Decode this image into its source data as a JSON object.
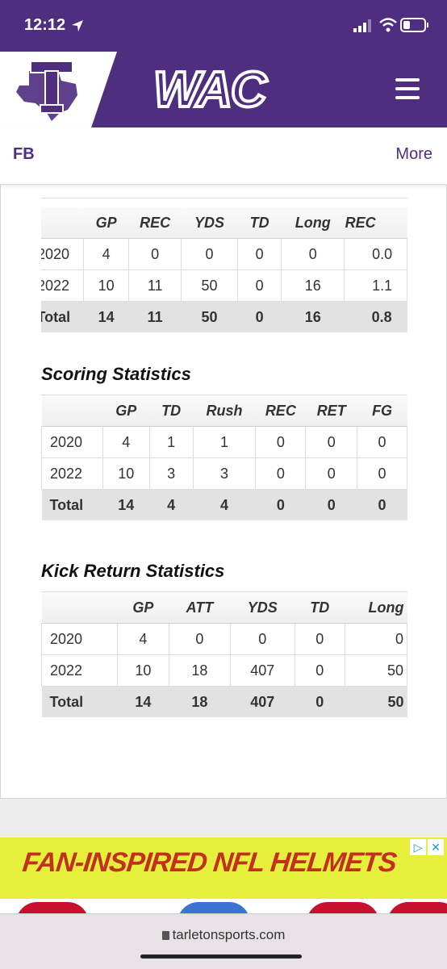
{
  "status": {
    "time": "12:12"
  },
  "header": {
    "brand_text": "WAC"
  },
  "subnav": {
    "left_label": "FB",
    "right_label": "More"
  },
  "receiving": {
    "columns": [
      "",
      "GP",
      "REC",
      "YDS",
      "TD",
      "Long",
      "REC"
    ],
    "rows": [
      [
        "2020",
        "4",
        "0",
        "0",
        "0",
        "0",
        "0.0"
      ],
      [
        "2022",
        "10",
        "11",
        "50",
        "0",
        "16",
        "1.1"
      ],
      [
        "Total",
        "14",
        "11",
        "50",
        "0",
        "16",
        "0.8"
      ]
    ]
  },
  "scoring": {
    "title": "Scoring Statistics",
    "columns": [
      "",
      "GP",
      "TD",
      "Rush",
      "REC",
      "RET",
      "FG"
    ],
    "rows": [
      [
        "2020",
        "4",
        "1",
        "1",
        "0",
        "0",
        "0"
      ],
      [
        "2022",
        "10",
        "3",
        "3",
        "0",
        "0",
        "0"
      ],
      [
        "Total",
        "14",
        "4",
        "4",
        "0",
        "0",
        "0"
      ]
    ]
  },
  "kick_return": {
    "title": "Kick Return Statistics",
    "columns": [
      "",
      "GP",
      "ATT",
      "YDS",
      "TD",
      "Long"
    ],
    "rows": [
      [
        "2020",
        "4",
        "0",
        "0",
        "0",
        "0"
      ],
      [
        "2022",
        "10",
        "18",
        "407",
        "0",
        "50"
      ],
      [
        "Total",
        "14",
        "18",
        "407",
        "0",
        "50"
      ]
    ]
  },
  "ad": {
    "headline": "FAN-INSPIRED NFL HELMETS",
    "controls": [
      "▷",
      "✕"
    ]
  },
  "browser": {
    "url": "tarletonsports.com"
  },
  "colors": {
    "brand_purple": "#4f2d7f",
    "ad_yellow": "#e6f03c",
    "ad_red": "#c2301f"
  },
  "icons": [
    "location-arrow-icon",
    "signal-icon",
    "wifi-icon",
    "battery-icon",
    "menu-icon",
    "lock-icon"
  ]
}
